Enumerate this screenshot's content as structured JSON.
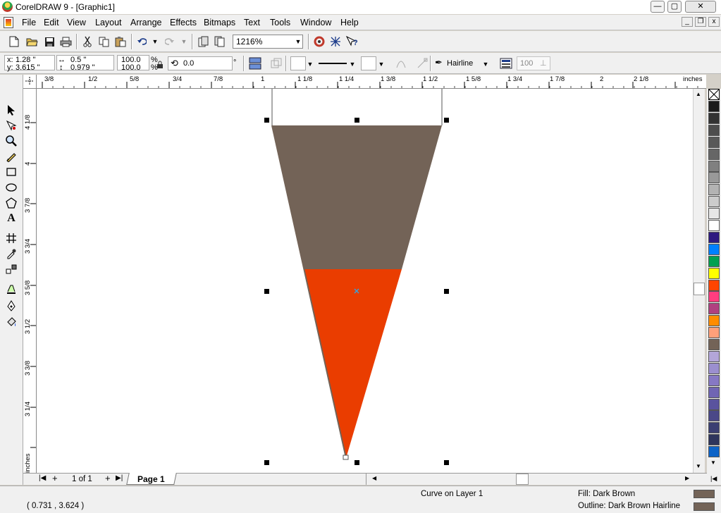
{
  "window": {
    "title": "CorelDRAW 9 - [Graphic1]",
    "minimize": "—",
    "maximize": "▢",
    "close": "✕"
  },
  "menu": [
    "File",
    "Edit",
    "View",
    "Layout",
    "Arrange",
    "Effects",
    "Bitmaps",
    "Text",
    "Tools",
    "Window",
    "Help"
  ],
  "mdi": {
    "minimize": "_",
    "restore": "❐",
    "close": "x"
  },
  "standard_toolbar": {
    "zoom_level": "1216%"
  },
  "property_bar": {
    "x_label": "x:",
    "x_value": "1.28 \"",
    "y_label": "y:",
    "y_value": "3.615 \"",
    "width_value": "0.5 \"",
    "height_value": "0.979 \"",
    "scale_x": "100.0",
    "scale_y": "100.0",
    "percent_x": "%",
    "percent_y": "%",
    "rotation_value": "0.0",
    "degree_sign": "°",
    "outline_width": "Hairline",
    "opacity_value": "100"
  },
  "ruler": {
    "units": "inches",
    "h_labels": [
      "3/8",
      "1/2",
      "5/8",
      "3/4",
      "7/8",
      "1",
      "1 1/8",
      "1 1/4",
      "1 3/8",
      "1 1/2",
      "1 5/8",
      "1 3/4",
      "1 7/8",
      "2",
      "2 1/8"
    ],
    "v_labels": [
      "4 1/8",
      "4",
      "3 7/8",
      "3 3/4",
      "3 5/8",
      "3 1/2",
      "3 3/8",
      "3 1/4",
      "inches"
    ]
  },
  "page_nav": {
    "counter": "1 of 1",
    "page_tab": "Page 1",
    "first": "|◀",
    "last": "▶|",
    "add_before": "+",
    "add_after": "+"
  },
  "status": {
    "coordinates": "( 0.731 , 3.624 )",
    "object_info": "Curve on Layer 1",
    "fill_info": "Fill: Dark Brown",
    "outline_info": "Outline: Dark Brown  Hairline"
  },
  "colors": {
    "dark_brown": "#736357",
    "orange_red": "#ea3d00",
    "palette": [
      "#1a1a1a",
      "#333333",
      "#4d4d4d",
      "#595959",
      "#666666",
      "#808080",
      "#999999",
      "#b3b3b3",
      "#cccccc",
      "#e6e6e6",
      "#ffffff",
      "#2e1a80",
      "#0080ff",
      "#00a050",
      "#ffff00",
      "#ff4500",
      "#ff3d7f",
      "#b04080",
      "#ff8c00",
      "#ffa07a",
      "#736357",
      "#b3a6d9",
      "#9b8fcf",
      "#8678c4",
      "#7065b3",
      "#5a539e",
      "#4a4888",
      "#3b3f72",
      "#2e355c",
      "#0d63c7"
    ]
  },
  "icons": {
    "new": "new-file-icon",
    "open": "open-folder-icon",
    "save": "save-icon",
    "print": "print-icon",
    "cut": "cut-icon",
    "copy": "copy-icon",
    "paste": "paste-icon",
    "undo": "undo-icon",
    "redo": "redo-icon"
  }
}
